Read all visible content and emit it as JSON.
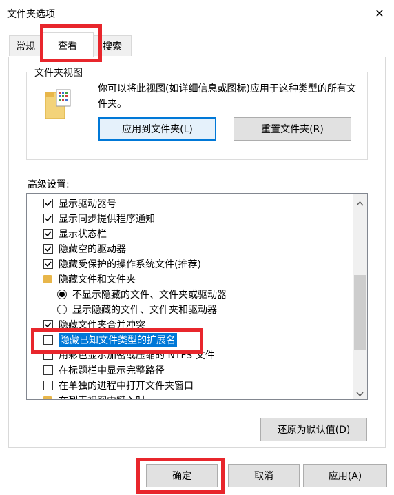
{
  "window": {
    "title": "文件夹选项",
    "close_glyph": "✕"
  },
  "tabs": [
    {
      "label": "常规"
    },
    {
      "label": "查看"
    },
    {
      "label": "搜索"
    }
  ],
  "folder_views": {
    "group_label": "文件夹视图",
    "description": "你可以将此视图(如详细信息或图标)应用于这种类型的所有文件夹。",
    "apply_button": "应用到文件夹(L)",
    "reset_button": "重置文件夹(R)"
  },
  "advanced": {
    "label": "高级设置:",
    "items": [
      {
        "type": "checkbox",
        "label": "显示驱动器号",
        "checked": true
      },
      {
        "type": "checkbox",
        "label": "显示同步提供程序通知",
        "checked": true
      },
      {
        "type": "checkbox",
        "label": "显示状态栏",
        "checked": true
      },
      {
        "type": "checkbox",
        "label": "隐藏空的驱动器",
        "checked": true
      },
      {
        "type": "checkbox",
        "label": "隐藏受保护的操作系统文件(推荐)",
        "checked": true
      },
      {
        "type": "folder",
        "label": "隐藏文件和文件夹"
      },
      {
        "type": "radio",
        "label": "不显示隐藏的文件、文件夹或驱动器",
        "checked": true
      },
      {
        "type": "radio",
        "label": "显示隐藏的文件、文件夹和驱动器",
        "checked": false
      },
      {
        "type": "checkbox",
        "label": "隐藏文件夹合并冲突",
        "checked": true
      },
      {
        "type": "checkbox",
        "label": "隐藏已知文件类型的扩展名",
        "checked": false,
        "selected": true
      },
      {
        "type": "checkbox",
        "label": "用彩色显示加密或压缩的 NTFS 文件",
        "checked": false
      },
      {
        "type": "checkbox",
        "label": "在标题栏中显示完整路径",
        "checked": false
      },
      {
        "type": "checkbox",
        "label": "在单独的进程中打开文件夹窗口",
        "checked": false
      },
      {
        "type": "folder",
        "label": "在列表视图中键入时"
      }
    ],
    "restore_button": "还原为默认值(D)"
  },
  "footer": {
    "ok_button": "确定",
    "cancel_button": "取消",
    "apply_button": "应用(A)"
  },
  "colors": {
    "highlight": "#e8262c",
    "selection": "#0078d7",
    "folder": "#e8b64a"
  }
}
